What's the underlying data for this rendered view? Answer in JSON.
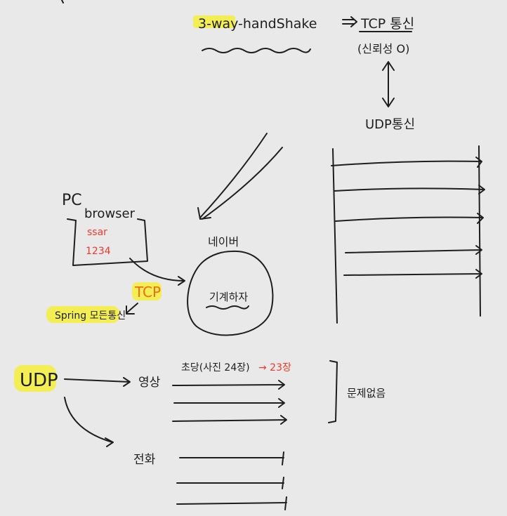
{
  "handshake": {
    "title": "3-way-handShake"
  },
  "tcp_note": {
    "title": "TCP 통신",
    "sub": "(신뢰성 O)"
  },
  "udp_note": {
    "title": "UDP통신"
  },
  "pc": {
    "label": "PC",
    "browser": "browser",
    "id": "ssar",
    "pw": "1234"
  },
  "tcp_label": "TCP",
  "spring_label": "Spring 모든통신",
  "naver": {
    "label": "네이버",
    "inner": "기계하자"
  },
  "udp_label": "UDP",
  "video": {
    "label": "영상",
    "note": "초당(사진 24장)",
    "arrow_note": "→ 23장"
  },
  "problem_note": "문제없음",
  "phone": {
    "label": "전화"
  }
}
